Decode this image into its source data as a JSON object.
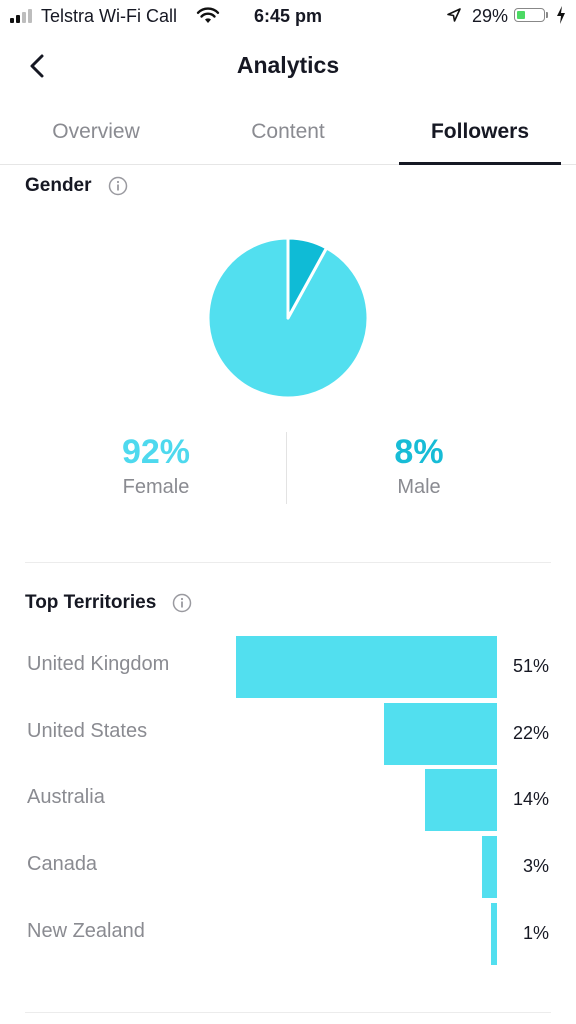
{
  "status_bar": {
    "carrier": "Telstra Wi-Fi Call",
    "time": "6:45 pm",
    "battery_pct": "29%"
  },
  "header": {
    "title": "Analytics"
  },
  "tabs": [
    {
      "label": "Overview",
      "active": false
    },
    {
      "label": "Content",
      "active": false
    },
    {
      "label": "Followers",
      "active": true
    }
  ],
  "gender": {
    "title": "Gender",
    "female": {
      "value": "92%",
      "label": "Female"
    },
    "male": {
      "value": "8%",
      "label": "Male"
    }
  },
  "territories": {
    "title": "Top Territories",
    "items": [
      {
        "name": "United Kingdom",
        "pct": "51%"
      },
      {
        "name": "United States",
        "pct": "22%"
      },
      {
        "name": "Australia",
        "pct": "14%"
      },
      {
        "name": "Canada",
        "pct": "3%"
      },
      {
        "name": "New Zealand",
        "pct": "1%"
      }
    ]
  },
  "colors": {
    "female": "#52dfef",
    "male": "#0fbbd6",
    "accent_text": "#161823"
  },
  "chart_data": [
    {
      "type": "pie",
      "categories": [
        "Female",
        "Male"
      ],
      "values": [
        92,
        8
      ]
    },
    {
      "type": "bar",
      "categories": [
        "United Kingdom",
        "United States",
        "Australia",
        "Canada",
        "New Zealand"
      ],
      "values": [
        51,
        22,
        14,
        3,
        1
      ]
    }
  ]
}
